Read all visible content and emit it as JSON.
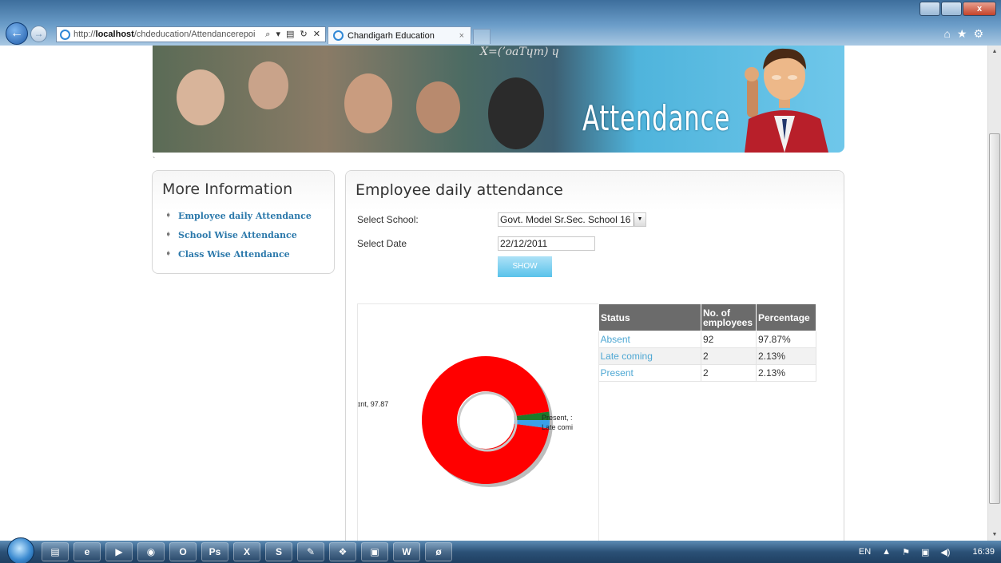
{
  "browser": {
    "url_prefix": "http://",
    "url_host": "localhost",
    "url_path": "/chdeducation/Attendancerepoi",
    "addr_controls": "⌕ ▾ ▤ ↻ ✕",
    "tab_title": "Chandigarh Education",
    "tab_close": "×",
    "back_glyph": "←",
    "forward_glyph": "→",
    "close_glyph": "x",
    "tools_glyphs": "⌂★⚙"
  },
  "banner": {
    "title": "Attendance",
    "chalk": "X=(ʼoaTɥm) ɥ"
  },
  "sidebar": {
    "title": "More Information",
    "items": [
      {
        "label": "Employee daily Attendance"
      },
      {
        "label": "School Wise Attendance"
      },
      {
        "label": "Class Wise Attendance"
      }
    ],
    "bullet": "➧"
  },
  "main": {
    "title": "Employee daily attendance",
    "school_label": "Select School:",
    "school_value": "Govt. Model Sr.Sec. School 16",
    "date_label": "Select Date",
    "date_value": "22/12/2011",
    "show_button": "SHOW"
  },
  "table": {
    "headers": [
      "Status",
      "No. of employees",
      "Percentage"
    ],
    "rows": [
      {
        "status": "Absent",
        "count": "92",
        "pct": "97.87%"
      },
      {
        "status": "Late coming",
        "count": "2",
        "pct": "2.13%"
      },
      {
        "status": "Present",
        "count": "2",
        "pct": "2.13%"
      }
    ]
  },
  "chart_data": {
    "type": "pie",
    "labels": [
      "Absent",
      "Late coming",
      "Present"
    ],
    "values": [
      97.87,
      2.13,
      2.13
    ],
    "colors": [
      "#ff0000",
      "#1e7a2a",
      "#3aa0e8"
    ],
    "data_labels": [
      "ɪnt, 97.87",
      "Late comi",
      "Present, :"
    ],
    "donut": true
  },
  "taskbar": {
    "apps": [
      "▤",
      "e",
      "▶",
      "◉",
      "O",
      "Ps",
      "X",
      "S",
      "✎",
      "❖",
      "▣",
      "W",
      "ø"
    ],
    "lang": "EN",
    "tray_up": "▲",
    "clock": "16:39"
  }
}
